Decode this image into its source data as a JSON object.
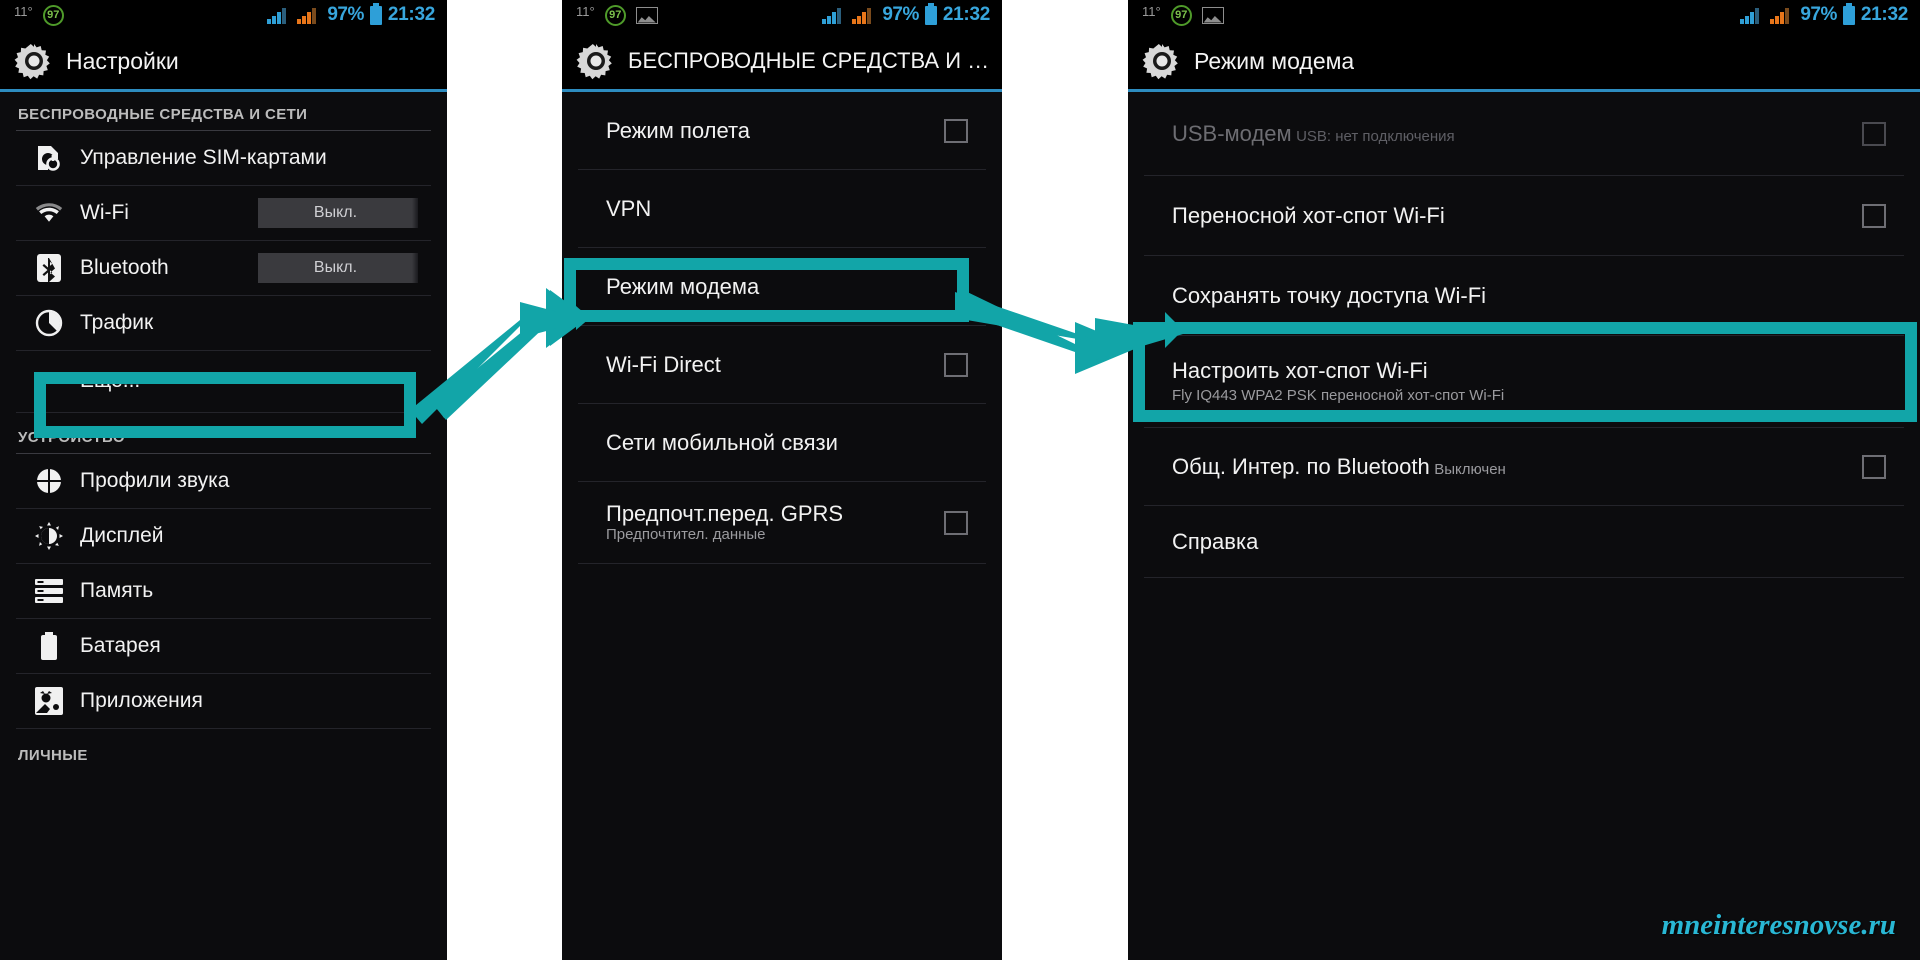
{
  "statusbar": {
    "temperature": "11°",
    "battery_circle": "97",
    "photo_icon": "photo-icon",
    "percent": "97%",
    "time": "21:32"
  },
  "panel1": {
    "title": "Настройки",
    "gear_icon": "gear-icon",
    "sections": [
      {
        "header": "БЕСПРОВОДНЫЕ СРЕДСТВА И СЕТИ",
        "items": [
          {
            "label": "Управление SIM-картами",
            "icon": "sim-card-icon",
            "value": ""
          },
          {
            "label": "Wi-Fi",
            "icon": "wifi-icon",
            "value": "Выкл."
          },
          {
            "label": "Bluetooth",
            "icon": "bluetooth-icon",
            "value": "Выкл."
          },
          {
            "label": "Трафик",
            "icon": "data-usage-icon",
            "value": ""
          },
          {
            "label": "Еще...",
            "icon": "",
            "value": ""
          }
        ]
      },
      {
        "header": "УСТРОЙСТВО",
        "items": [
          {
            "label": "Профили звука",
            "icon": "sound-profile-icon",
            "value": ""
          },
          {
            "label": "Дисплей",
            "icon": "display-icon",
            "value": ""
          },
          {
            "label": "Память",
            "icon": "storage-icon",
            "value": ""
          },
          {
            "label": "Батарея",
            "icon": "battery-icon",
            "value": ""
          },
          {
            "label": "Приложения",
            "icon": "apps-icon",
            "value": ""
          }
        ]
      },
      {
        "header": "ЛИЧНЫЕ",
        "items": []
      }
    ]
  },
  "panel2": {
    "title": "БЕСПРОВОДНЫЕ СРЕДСТВА И СЕ...",
    "gear_icon": "gear-icon",
    "items": [
      {
        "label": "Режим полета",
        "sub": "",
        "checkbox": true
      },
      {
        "label": "VPN",
        "sub": "",
        "checkbox": false
      },
      {
        "label": "Режим модема",
        "sub": "",
        "checkbox": false
      },
      {
        "label": "Wi-Fi Direct",
        "sub": "",
        "checkbox": true
      },
      {
        "label": "Сети мобильной связи",
        "sub": "",
        "checkbox": false
      },
      {
        "label": "Предпочт.перед. GPRS",
        "sub": "Предпочтител. данные",
        "checkbox": true
      }
    ]
  },
  "panel3": {
    "title": "Режим модема",
    "gear_icon": "gear-icon",
    "items": [
      {
        "label": "USB-модем",
        "sub": "USB: нет подключения",
        "checkbox": true,
        "disabled": true
      },
      {
        "label": "Переносной хот-спот Wi-Fi",
        "sub": "",
        "checkbox": true,
        "disabled": false
      },
      {
        "label": "Сохранять точку доступа Wi-Fi",
        "sub": "",
        "checkbox": false,
        "disabled": false
      },
      {
        "label": "Настроить хот-спот Wi-Fi",
        "sub": "Fly IQ443 WPA2 PSK переносной хот-спот Wi-Fi",
        "checkbox": false,
        "disabled": false
      },
      {
        "label": "Общ. Интер. по Bluetooth",
        "sub": "Выключен",
        "checkbox": true,
        "disabled": false
      },
      {
        "label": "Справка",
        "sub": "",
        "checkbox": false,
        "disabled": false
      }
    ]
  },
  "annotations": {
    "highlight_color": "#12a5a8",
    "arrow_color": "#12a5a8",
    "highlight_1_target": "Еще...",
    "highlight_2_target": "Режим модема",
    "highlight_3_target": "Настроить хот-спот Wi-Fi"
  },
  "watermark": {
    "text": "mneinteresnovse.ru",
    "color": "#29b7d4"
  }
}
